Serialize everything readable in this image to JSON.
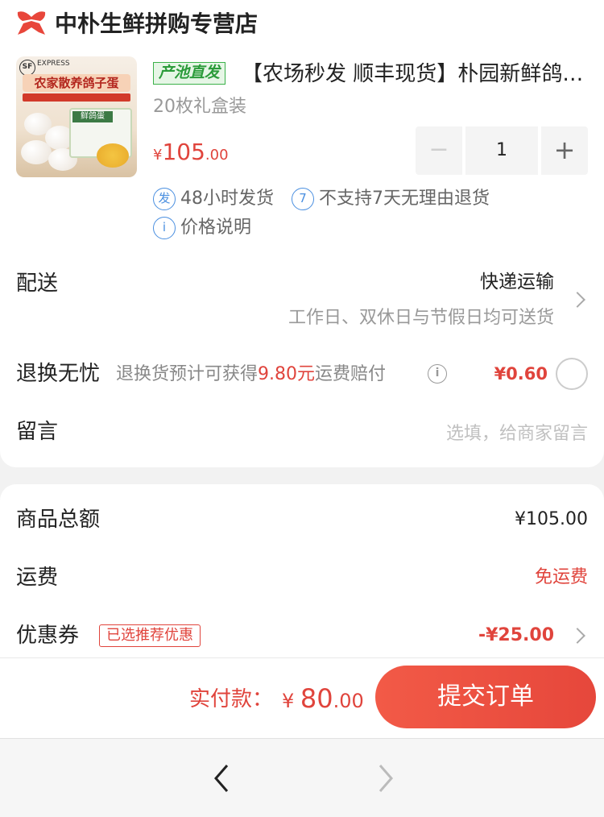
{
  "shop": {
    "name": "中朴生鲜拼购专营店",
    "logo_icon": "shop-bow-icon",
    "logo_color": "#e8463b"
  },
  "product": {
    "image_banner": "农家散养鸽子蛋",
    "image_box_label": "鲜鸽蛋",
    "image_sf_mark": "SF",
    "image_express": "EXPRESS",
    "origin_tag": "产池直发",
    "title": "【农场秒发 顺丰现货】朴园新鲜鸽子蛋",
    "spec": "20枚礼盒装",
    "price_symbol": "¥",
    "price_int": "105",
    "price_dec": ".00",
    "quantity": "1",
    "minus": "−",
    "plus": "+"
  },
  "services": [
    {
      "icon_text": "发",
      "label": "48小时发货",
      "icon": "ship-icon"
    },
    {
      "icon_text": "7",
      "label": "不支持7天无理由退货",
      "icon": "no-return-icon"
    },
    {
      "icon_text": "i",
      "label": "价格说明",
      "icon": "info-icon"
    }
  ],
  "delivery": {
    "label": "配送",
    "method": "快递运输",
    "note": "工作日、双休日与节假日均可送货"
  },
  "return": {
    "label": "退换无忧",
    "note_prefix": "退换货预计可获得",
    "note_amount": "9.80元",
    "note_suffix": "运费赔付",
    "price": "¥0.60",
    "info_icon_text": "i"
  },
  "message": {
    "label": "留言",
    "placeholder": "选填，给商家留言"
  },
  "summary": {
    "total_label": "商品总额",
    "total_value": "¥105.00",
    "shipping_label": "运费",
    "shipping_value": "免运费",
    "coupon_label": "优惠券",
    "coupon_tag": "已选推荐优惠",
    "coupon_value": "-¥25.00"
  },
  "checkout": {
    "pay_label": "实付款：",
    "pay_symbol": "¥ ",
    "pay_int": "80",
    "pay_dec": ".00",
    "submit": "提交订单",
    "accent": "#e0443c"
  },
  "nav": {
    "back_icon": "chevron-left-icon",
    "forward_icon": "chevron-right-icon"
  }
}
